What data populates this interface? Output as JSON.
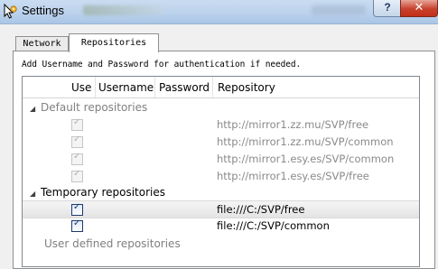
{
  "window": {
    "title": "Settings",
    "help_label": "?",
    "close_label": "✕"
  },
  "tabs": [
    {
      "label": "Network",
      "selected": false
    },
    {
      "label": "Repositories",
      "selected": true
    }
  ],
  "hint": "Add Username and Password for authentication if needed.",
  "columns": [
    "Use",
    "Username",
    "Password",
    "Repository"
  ],
  "groups": {
    "default": {
      "label": "Default repositories",
      "rows": [
        {
          "checked": true,
          "url": "http://mirror1.zz.mu/SVP/free"
        },
        {
          "checked": true,
          "url": "http://mirror1.zz.mu/SVP/common"
        },
        {
          "checked": true,
          "url": "http://mirror1.esy.es/SVP/common"
        },
        {
          "checked": true,
          "url": "http://mirror1.esy.es/SVP/free"
        }
      ]
    },
    "temporary": {
      "label": "Temporary repositories",
      "rows": [
        {
          "checked": true,
          "url": "file:///C:/SVP/free"
        },
        {
          "checked": true,
          "url": "file:///C:/SVP/common"
        }
      ]
    },
    "user": {
      "label": "User defined repositories"
    }
  },
  "colors": {
    "titlebar": "#bcd2ec",
    "close_button": "#c8402c",
    "disabled_text": "#808080"
  }
}
